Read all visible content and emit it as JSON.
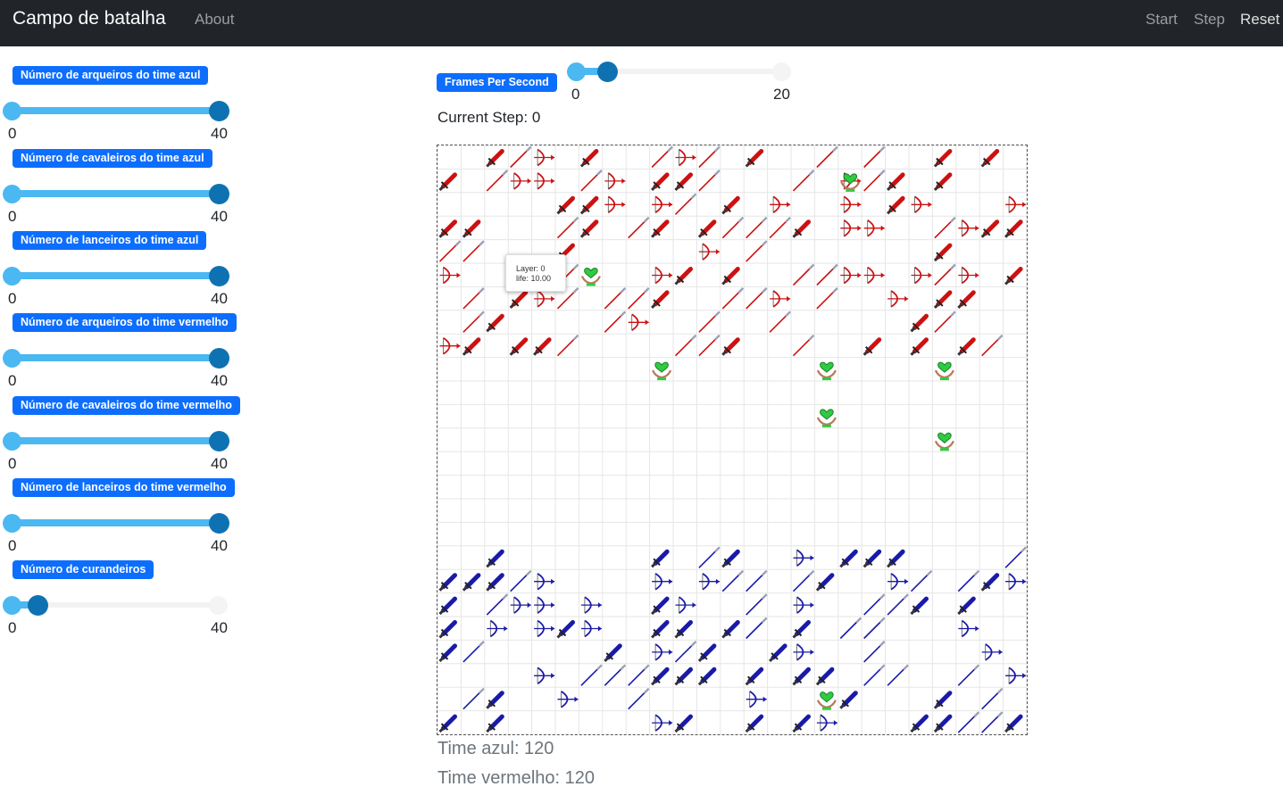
{
  "navbar": {
    "brand": "Campo de batalha",
    "about": "About",
    "start": "Start",
    "step": "Step",
    "reset": "Reset"
  },
  "sliders": [
    {
      "label": "Número de arqueiros do time azul",
      "min": "0",
      "max": "40",
      "value": 40
    },
    {
      "label": "Número de cavaleiros do time azul",
      "min": "0",
      "max": "40",
      "value": 40
    },
    {
      "label": "Número de lanceiros do time azul",
      "min": "0",
      "max": "40",
      "value": 40
    },
    {
      "label": "Número de arqueiros do time vermelho",
      "min": "0",
      "max": "40",
      "value": 40
    },
    {
      "label": "Número de cavaleiros do time vermelho",
      "min": "0",
      "max": "40",
      "value": 40
    },
    {
      "label": "Número de lanceiros do time vermelho",
      "min": "0",
      "max": "40",
      "value": 40
    },
    {
      "label": "Número de curandeiros",
      "min": "0",
      "max": "40",
      "value": 5
    }
  ],
  "fps": {
    "label": "Frames Per Second",
    "min": "0",
    "max": "20",
    "value": 3
  },
  "current_step": "Current Step: 0",
  "tooltip": {
    "line1": "Layer: 0",
    "line2": "life: 10.00"
  },
  "scores": {
    "blue": "Time azul: 120",
    "red": "Time vermelho: 120"
  },
  "colors": {
    "red_team": "#cc1111",
    "blue_team": "#1a1aa8",
    "healer": "#2ecc40",
    "accent": "#0d6efd"
  }
}
